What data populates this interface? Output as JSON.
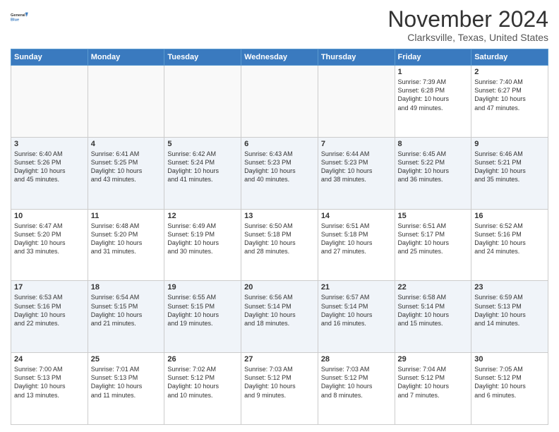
{
  "header": {
    "logo_line1": "General",
    "logo_line2": "Blue",
    "month": "November 2024",
    "location": "Clarksville, Texas, United States"
  },
  "weekdays": [
    "Sunday",
    "Monday",
    "Tuesday",
    "Wednesday",
    "Thursday",
    "Friday",
    "Saturday"
  ],
  "weeks": [
    [
      {
        "day": "",
        "info": ""
      },
      {
        "day": "",
        "info": ""
      },
      {
        "day": "",
        "info": ""
      },
      {
        "day": "",
        "info": ""
      },
      {
        "day": "",
        "info": ""
      },
      {
        "day": "1",
        "info": "Sunrise: 7:39 AM\nSunset: 6:28 PM\nDaylight: 10 hours\nand 49 minutes."
      },
      {
        "day": "2",
        "info": "Sunrise: 7:40 AM\nSunset: 6:27 PM\nDaylight: 10 hours\nand 47 minutes."
      }
    ],
    [
      {
        "day": "3",
        "info": "Sunrise: 6:40 AM\nSunset: 5:26 PM\nDaylight: 10 hours\nand 45 minutes."
      },
      {
        "day": "4",
        "info": "Sunrise: 6:41 AM\nSunset: 5:25 PM\nDaylight: 10 hours\nand 43 minutes."
      },
      {
        "day": "5",
        "info": "Sunrise: 6:42 AM\nSunset: 5:24 PM\nDaylight: 10 hours\nand 41 minutes."
      },
      {
        "day": "6",
        "info": "Sunrise: 6:43 AM\nSunset: 5:23 PM\nDaylight: 10 hours\nand 40 minutes."
      },
      {
        "day": "7",
        "info": "Sunrise: 6:44 AM\nSunset: 5:23 PM\nDaylight: 10 hours\nand 38 minutes."
      },
      {
        "day": "8",
        "info": "Sunrise: 6:45 AM\nSunset: 5:22 PM\nDaylight: 10 hours\nand 36 minutes."
      },
      {
        "day": "9",
        "info": "Sunrise: 6:46 AM\nSunset: 5:21 PM\nDaylight: 10 hours\nand 35 minutes."
      }
    ],
    [
      {
        "day": "10",
        "info": "Sunrise: 6:47 AM\nSunset: 5:20 PM\nDaylight: 10 hours\nand 33 minutes."
      },
      {
        "day": "11",
        "info": "Sunrise: 6:48 AM\nSunset: 5:20 PM\nDaylight: 10 hours\nand 31 minutes."
      },
      {
        "day": "12",
        "info": "Sunrise: 6:49 AM\nSunset: 5:19 PM\nDaylight: 10 hours\nand 30 minutes."
      },
      {
        "day": "13",
        "info": "Sunrise: 6:50 AM\nSunset: 5:18 PM\nDaylight: 10 hours\nand 28 minutes."
      },
      {
        "day": "14",
        "info": "Sunrise: 6:51 AM\nSunset: 5:18 PM\nDaylight: 10 hours\nand 27 minutes."
      },
      {
        "day": "15",
        "info": "Sunrise: 6:51 AM\nSunset: 5:17 PM\nDaylight: 10 hours\nand 25 minutes."
      },
      {
        "day": "16",
        "info": "Sunrise: 6:52 AM\nSunset: 5:16 PM\nDaylight: 10 hours\nand 24 minutes."
      }
    ],
    [
      {
        "day": "17",
        "info": "Sunrise: 6:53 AM\nSunset: 5:16 PM\nDaylight: 10 hours\nand 22 minutes."
      },
      {
        "day": "18",
        "info": "Sunrise: 6:54 AM\nSunset: 5:15 PM\nDaylight: 10 hours\nand 21 minutes."
      },
      {
        "day": "19",
        "info": "Sunrise: 6:55 AM\nSunset: 5:15 PM\nDaylight: 10 hours\nand 19 minutes."
      },
      {
        "day": "20",
        "info": "Sunrise: 6:56 AM\nSunset: 5:14 PM\nDaylight: 10 hours\nand 18 minutes."
      },
      {
        "day": "21",
        "info": "Sunrise: 6:57 AM\nSunset: 5:14 PM\nDaylight: 10 hours\nand 16 minutes."
      },
      {
        "day": "22",
        "info": "Sunrise: 6:58 AM\nSunset: 5:14 PM\nDaylight: 10 hours\nand 15 minutes."
      },
      {
        "day": "23",
        "info": "Sunrise: 6:59 AM\nSunset: 5:13 PM\nDaylight: 10 hours\nand 14 minutes."
      }
    ],
    [
      {
        "day": "24",
        "info": "Sunrise: 7:00 AM\nSunset: 5:13 PM\nDaylight: 10 hours\nand 13 minutes."
      },
      {
        "day": "25",
        "info": "Sunrise: 7:01 AM\nSunset: 5:13 PM\nDaylight: 10 hours\nand 11 minutes."
      },
      {
        "day": "26",
        "info": "Sunrise: 7:02 AM\nSunset: 5:12 PM\nDaylight: 10 hours\nand 10 minutes."
      },
      {
        "day": "27",
        "info": "Sunrise: 7:03 AM\nSunset: 5:12 PM\nDaylight: 10 hours\nand 9 minutes."
      },
      {
        "day": "28",
        "info": "Sunrise: 7:03 AM\nSunset: 5:12 PM\nDaylight: 10 hours\nand 8 minutes."
      },
      {
        "day": "29",
        "info": "Sunrise: 7:04 AM\nSunset: 5:12 PM\nDaylight: 10 hours\nand 7 minutes."
      },
      {
        "day": "30",
        "info": "Sunrise: 7:05 AM\nSunset: 5:12 PM\nDaylight: 10 hours\nand 6 minutes."
      }
    ]
  ]
}
